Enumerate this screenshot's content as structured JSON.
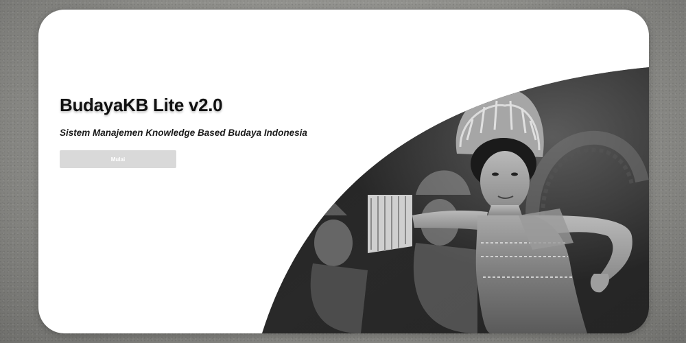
{
  "hero": {
    "title": "BudayaKB Lite v2.0",
    "subtitle": "Sistem Manajemen Knowledge Based Budaya Indonesia",
    "start_button_label": "Mulai",
    "image_alt": "Balinese dancers performing"
  },
  "colors": {
    "background": "#9a9a96",
    "card": "#ffffff",
    "button": "#d9d9d9",
    "button_text": "#ffffff",
    "title": "#111111"
  }
}
